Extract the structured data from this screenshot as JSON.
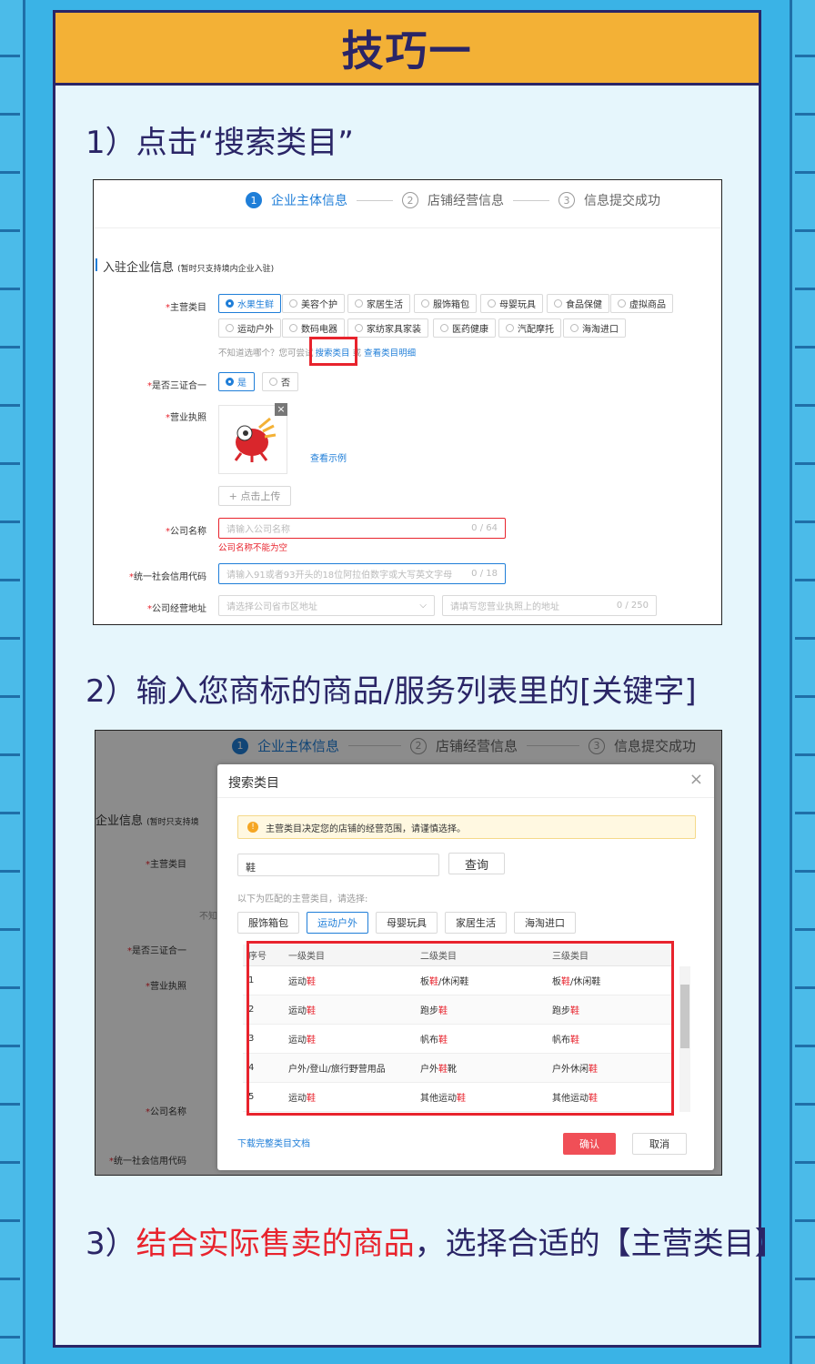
{
  "card": {
    "title": "技巧一",
    "step1": "1）点击“搜索类目”",
    "step2": "2）输入您商标的商品/服务列表里的[关键字]",
    "step3_prefix": "3）",
    "step3_red": "结合实际售卖的商品",
    "step3_suffix": "，选择合适的【主营类目】"
  },
  "shot1": {
    "progress": [
      "企业主体信息",
      "店铺经营信息",
      "信息提交成功"
    ],
    "progress_nums": [
      "1",
      "2",
      "3"
    ],
    "section_title": "入驻企业信息",
    "section_note": "(暂时只支持境内企业入驻)",
    "label_category": "主营类目",
    "categories_row1": [
      "水果生鲜",
      "美容个护",
      "家居生活",
      "服饰箱包",
      "母婴玩具",
      "食品保健",
      "虚拟商品"
    ],
    "categories_row2": [
      "运动户外",
      "数码电器",
      "家纺家具家装",
      "医药健康",
      "汽配摩托",
      "海淘进口"
    ],
    "hint_prefix": "不知道选哪个？您可尝试",
    "hint_search": "搜索类目",
    "hint_or": "或",
    "hint_detail": "查看类目明细",
    "label_three": "是否三证合一",
    "yes": "是",
    "no": "否",
    "label_license": "营业执照",
    "view_example": "查看示例",
    "upload": "+ 点击上传",
    "label_company": "公司名称",
    "company_placeholder": "请输入公司名称",
    "company_count": "0 / 64",
    "company_error": "公司名称不能为空",
    "label_credit": "统一社会信用代码",
    "credit_placeholder": "请输入91或者93开头的18位阿拉伯数字或大写英文字母",
    "credit_count": "0 / 18",
    "label_address": "公司经营地址",
    "address_select": "请选择公司省市区地址",
    "address_placeholder": "请填写您营业执照上的地址",
    "address_count": "0 / 250"
  },
  "shot2": {
    "progress": [
      "企业主体信息",
      "店铺经营信息",
      "信息提交成功"
    ],
    "progress_nums": [
      "1",
      "2",
      "3"
    ],
    "bg_section": "企业信息",
    "bg_note": "(暂时只支持境",
    "bg_labels": [
      "主营类目",
      "是否三证合一",
      "营业执照",
      "公司名称",
      "统一社会信用代码"
    ],
    "bg_hint": "不知",
    "modal_title": "搜索类目",
    "close": "×",
    "notice": "主营类目决定您的店铺的经营范围，请谨慎选择。",
    "search_value": "鞋",
    "search_btn": "查询",
    "match_hint": "以下为匹配的主营类目，请选择:",
    "tags": [
      "服饰箱包",
      "运动户外",
      "母婴玩具",
      "家居生活",
      "海淘进口"
    ],
    "columns": [
      "序号",
      "一级类目",
      "二级类目",
      "三级类目"
    ],
    "rows": [
      {
        "no": "1",
        "l1a": "运动",
        "l1b": "鞋",
        "l1c": "",
        "l2a": "板",
        "l2b": "鞋",
        "l2c": "/休闲鞋",
        "l3a": "板",
        "l3b": "鞋",
        "l3c": "/休闲鞋"
      },
      {
        "no": "2",
        "l1a": "运动",
        "l1b": "鞋",
        "l1c": "",
        "l2a": "跑步",
        "l2b": "鞋",
        "l2c": "",
        "l3a": "跑步",
        "l3b": "鞋",
        "l3c": ""
      },
      {
        "no": "3",
        "l1a": "运动",
        "l1b": "鞋",
        "l1c": "",
        "l2a": "帆布",
        "l2b": "鞋",
        "l2c": "",
        "l3a": "帆布",
        "l3b": "鞋",
        "l3c": ""
      },
      {
        "no": "4",
        "l1a": "户外/登山/旅行野营用品",
        "l1b": "",
        "l1c": "",
        "l2a": "户外",
        "l2b": "鞋",
        "l2c": "靴",
        "l3a": "户外休闲",
        "l3b": "鞋",
        "l3c": ""
      },
      {
        "no": "5",
        "l1a": "运动",
        "l1b": "鞋",
        "l1c": "",
        "l2a": "其他运动",
        "l2b": "鞋",
        "l2c": "",
        "l3a": "其他运动",
        "l3b": "鞋",
        "l3c": ""
      }
    ],
    "download": "下载完整类目文档",
    "confirm": "确认",
    "cancel": "取消"
  },
  "colors": {
    "accent": "#1f7ed8",
    "highlight": "#e8232d",
    "header": "#f3b136",
    "navy": "#2a2566"
  }
}
